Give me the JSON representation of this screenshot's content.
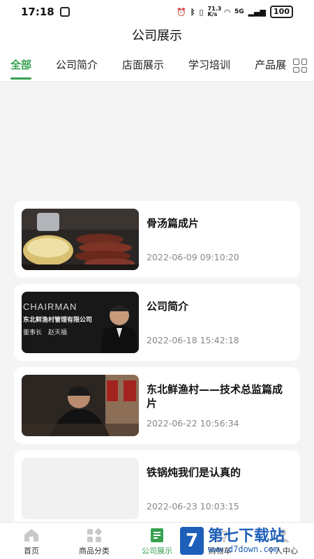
{
  "status_bar": {
    "time": "17:18",
    "speed": "71.3 K/s",
    "network": "5G",
    "battery": "100"
  },
  "header": {
    "title": "公司展示"
  },
  "tabs": [
    {
      "label": "全部",
      "active": true
    },
    {
      "label": "公司简介",
      "active": false
    },
    {
      "label": "店面展示",
      "active": false
    },
    {
      "label": "学习培训",
      "active": false
    },
    {
      "label": "产品展示",
      "active": false
    }
  ],
  "articles": [
    {
      "title": "骨汤篇成片",
      "date": "2022-06-09 09:10:20",
      "thumb_icon": "food-photo"
    },
    {
      "title": "公司简介",
      "date": "2022-06-18 15:42:18",
      "thumb_icon": "chairman-photo",
      "thumb_text_1": "CHAIRMAN",
      "thumb_text_2": "东北鲜渔村管理有限公司",
      "thumb_text_3": "董事长　赵天福"
    },
    {
      "title": "东北鲜渔村——技术总监篇成片",
      "date": "2022-06-22 10:56:34",
      "thumb_icon": "director-photo"
    },
    {
      "title": "铁锅炖我们是认真的",
      "date": "2022-06-23 10:03:15",
      "thumb_icon": "placeholder"
    }
  ],
  "bottom_nav": [
    {
      "label": "首页",
      "icon": "home-icon",
      "active": false
    },
    {
      "label": "商品分类",
      "icon": "category-icon",
      "active": false
    },
    {
      "label": "公司展示",
      "icon": "company-icon",
      "active": true
    },
    {
      "label": "购物车",
      "icon": "cart-icon",
      "active": false
    },
    {
      "label": "个人中心",
      "icon": "user-icon",
      "active": false
    }
  ],
  "watermark": {
    "logo": "7",
    "title": "第七下载站",
    "url": "www.d7down.com"
  },
  "colors": {
    "accent": "#35a150",
    "watermark": "#1d5fb9"
  }
}
